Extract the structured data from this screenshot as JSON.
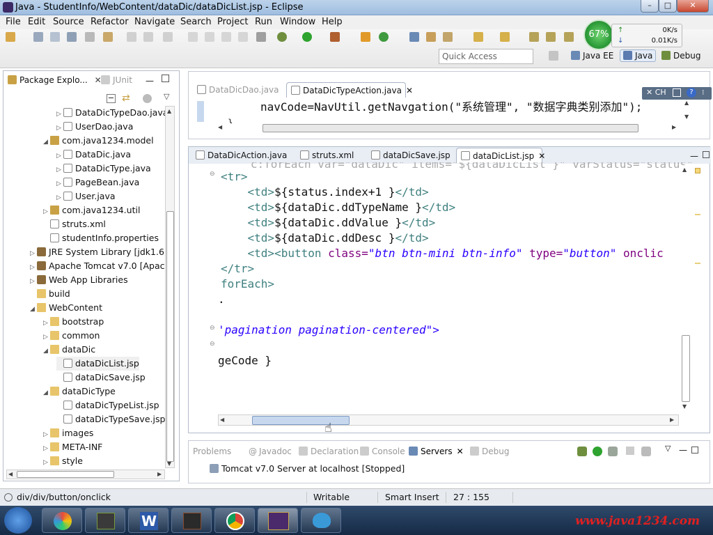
{
  "window": {
    "title": "Java - StudentInfo/WebContent/dataDic/dataDicList.jsp - Eclipse",
    "min": "–",
    "max": "□",
    "close": "✕"
  },
  "menu": [
    "File",
    "Edit",
    "Source",
    "Refactor",
    "Navigate",
    "Search",
    "Project",
    "Run",
    "Window",
    "Help"
  ],
  "toolbar": {
    "quick_access_placeholder": "Quick Access"
  },
  "perspectives": [
    {
      "label": "Java EE"
    },
    {
      "label": "Java",
      "active": true
    },
    {
      "label": "Debug"
    }
  ],
  "network": {
    "percent": "67%",
    "up": "0K/s",
    "down": "0.01K/s"
  },
  "explorer": {
    "tabs": [
      "Package Explo...",
      "JUnit"
    ],
    "rows": [
      {
        "label": "DataDicTypeDao.java",
        "indent": 2,
        "icon": "j",
        "arrow": "▷"
      },
      {
        "label": "UserDao.java",
        "indent": 2,
        "icon": "j",
        "arrow": "▷"
      },
      {
        "label": "com.java1234.model",
        "indent": 1,
        "icon": "pk",
        "arrow": "◢"
      },
      {
        "label": "DataDic.java",
        "indent": 2,
        "icon": "j",
        "arrow": "▷"
      },
      {
        "label": "DataDicType.java",
        "indent": 2,
        "icon": "j",
        "arrow": "▷"
      },
      {
        "label": "PageBean.java",
        "indent": 2,
        "icon": "j",
        "arrow": "▷"
      },
      {
        "label": "User.java",
        "indent": 2,
        "icon": "j",
        "arrow": "▷"
      },
      {
        "label": "com.java1234.util",
        "indent": 1,
        "icon": "pk",
        "arrow": "▷"
      },
      {
        "label": "struts.xml",
        "indent": 1,
        "icon": "xml",
        "arrow": ""
      },
      {
        "label": "studentInfo.properties",
        "indent": 1,
        "icon": "fl",
        "arrow": ""
      },
      {
        "label": "JRE System Library [jdk1.6]",
        "indent": 0,
        "icon": "lib",
        "arrow": "▷"
      },
      {
        "label": "Apache Tomcat v7.0 [Apach",
        "indent": 0,
        "icon": "lib",
        "arrow": "▷"
      },
      {
        "label": "Web App Libraries",
        "indent": 0,
        "icon": "lib",
        "arrow": "▷"
      },
      {
        "label": "build",
        "indent": 0,
        "icon": "fd",
        "arrow": ""
      },
      {
        "label": "WebContent",
        "indent": 0,
        "icon": "fd",
        "arrow": "◢"
      },
      {
        "label": "bootstrap",
        "indent": 1,
        "icon": "fd",
        "arrow": "▷"
      },
      {
        "label": "common",
        "indent": 1,
        "icon": "fd",
        "arrow": "▷"
      },
      {
        "label": "dataDic",
        "indent": 1,
        "icon": "fd",
        "arrow": "◢"
      },
      {
        "label": "dataDicList.jsp",
        "indent": 2,
        "icon": "fl",
        "arrow": "",
        "selected": true
      },
      {
        "label": "dataDicSave.jsp",
        "indent": 2,
        "icon": "fl",
        "arrow": ""
      },
      {
        "label": "dataDicType",
        "indent": 1,
        "icon": "fd",
        "arrow": "◢"
      },
      {
        "label": "dataDicTypeList.jsp",
        "indent": 2,
        "icon": "fl",
        "arrow": ""
      },
      {
        "label": "dataDicTypeSave.jsp",
        "indent": 2,
        "icon": "fl",
        "arrow": ""
      },
      {
        "label": "images",
        "indent": 1,
        "icon": "fd",
        "arrow": "▷"
      },
      {
        "label": "META-INF",
        "indent": 1,
        "icon": "fd",
        "arrow": "▷"
      },
      {
        "label": "style",
        "indent": 1,
        "icon": "fd",
        "arrow": "▷"
      }
    ]
  },
  "editor_top": {
    "tabs": [
      {
        "label": "DataDicDao.java",
        "active": false
      },
      {
        "label": "DataDicTypeAction.java",
        "active": true
      }
    ],
    "code": "navCode=NavUtil.getNavgation(\"系统管理\", \"数据字典类别添加\");"
  },
  "editor_main": {
    "tabs": [
      {
        "label": "DataDicAction.java",
        "active": false
      },
      {
        "label": "struts.xml",
        "active": false
      },
      {
        "label": "dataDicSave.jsp",
        "active": false
      },
      {
        "label": "dataDicList.jsp",
        "active": true
      }
    ],
    "lines": [
      {
        "prefix": "<tr>",
        "content": ""
      },
      {
        "prefix": "    <td>",
        "content": "${status.index+1 }",
        "suffix": "</td>"
      },
      {
        "prefix": "    <td>",
        "content": "${dataDic.ddTypeName }",
        "suffix": "</td>"
      },
      {
        "prefix": "    <td>",
        "content": "${dataDic.ddValue }",
        "suffix": "</td>"
      },
      {
        "prefix": "    <td>",
        "content": "${dataDic.ddDesc }",
        "suffix": "</td>"
      },
      {
        "prefix": "    <td><button ",
        "content": "",
        "suffix": ""
      },
      {
        "prefix": "</tr>",
        "content": ""
      },
      {
        "prefix": "forEach>",
        "content": ""
      },
      {
        "prefix": ".",
        "content": ""
      },
      {
        "prefix": "",
        "content": ""
      },
      {
        "prefix": "'pagination pagination-centered\">",
        "content": ""
      },
      {
        "prefix": "",
        "content": ""
      },
      {
        "prefix": "geCode }",
        "content": ""
      }
    ],
    "button_line": {
      "attr1": "class=",
      "val1": "\"btn btn-mini btn-info\"",
      "attr2": " type=",
      "val2": "\"button\"",
      "attr3": " onclic"
    }
  },
  "bottom": {
    "tabs": [
      "Problems",
      "Javadoc",
      "Declaration",
      "Console",
      "Servers",
      "Debug"
    ],
    "active_tab": "Servers",
    "server_row": "Tomcat v7.0 Server at localhost  [Stopped]"
  },
  "status": {
    "path": "div/div/button/onclick",
    "writable": "Writable",
    "mode": "Smart Insert",
    "pos": "27 : 155"
  },
  "watermark": "www.java1234.com"
}
